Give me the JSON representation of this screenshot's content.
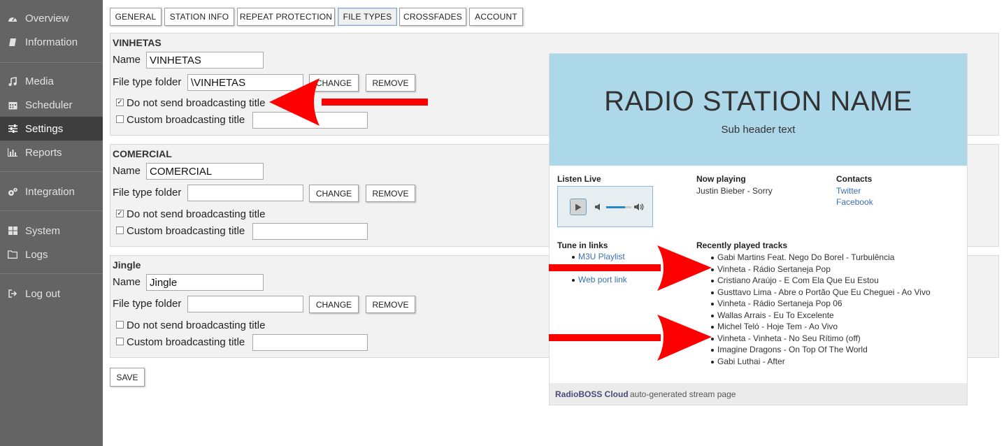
{
  "sidebar": {
    "items": [
      {
        "label": "Overview",
        "icon": "dashboard-icon"
      },
      {
        "label": "Information",
        "icon": "book-icon"
      },
      {
        "label": "Media",
        "icon": "music-icon"
      },
      {
        "label": "Scheduler",
        "icon": "calendar-icon"
      },
      {
        "label": "Settings",
        "icon": "sliders-icon",
        "active": true
      },
      {
        "label": "Reports",
        "icon": "bar-chart-icon"
      },
      {
        "label": "Integration",
        "icon": "cogs-icon"
      },
      {
        "label": "System",
        "icon": "windows-icon"
      },
      {
        "label": "Logs",
        "icon": "folder-icon"
      },
      {
        "label": "Log out",
        "icon": "sign-out-icon"
      }
    ]
  },
  "tabs": [
    "GENERAL",
    "STATION INFO",
    "REPEAT PROTECTION",
    "FILE TYPES",
    "CROSSFADES",
    "ACCOUNT"
  ],
  "active_tab": "FILE TYPES",
  "labels": {
    "name": "Name",
    "folder": "File type folder",
    "change": "CHANGE",
    "remove": "REMOVE",
    "no_title": "Do not send broadcasting title",
    "custom_title": "Custom broadcasting title"
  },
  "sections": [
    {
      "title": "VINHETAS",
      "name": "VINHETAS",
      "folder": "\\VINHETAS",
      "no_title_checked": true,
      "custom_checked": false,
      "custom_value": ""
    },
    {
      "title": "COMERCIAL",
      "name": "COMERCIAL",
      "folder": "",
      "no_title_checked": true,
      "custom_checked": false,
      "custom_value": ""
    },
    {
      "title": "Jingle",
      "name": "Jingle",
      "folder": "",
      "no_title_checked": false,
      "custom_checked": false,
      "custom_value": ""
    }
  ],
  "save_label": "SAVE",
  "stream_page": {
    "title": "RADIO STATION NAME",
    "subtitle": "Sub header text",
    "listen_live": "Listen Live",
    "now_playing_label": "Now playing",
    "now_playing": "Justin Bieber - Sorry",
    "contacts_label": "Contacts",
    "contacts": [
      "Twitter",
      "Facebook"
    ],
    "tune_in_label": "Tune in links",
    "tune_in": [
      "M3U Playlist",
      "Web port link"
    ],
    "recent_label": "Recently played tracks",
    "recent": [
      "Gabi Martins Feat. Nego Do Borel - Turbulência",
      "Vinheta - Rádio Sertaneja Pop",
      "Cristiano Araújo - E Com Ela Que Eu Estou",
      "Gusttavo Lima - Abre o Portão Que Eu Cheguei - Ao Vivo",
      "Vinheta - Rádio Sertaneja Pop 06",
      "Wallas Arrais - Eu To Excelente",
      "Michel Teló - Hoje Tem - Ao Vivo",
      "Vinheta - Vinheta - No Seu Rítimo (off)",
      "Imagine Dragons - On Top Of The World",
      "Gabi Luthai - After"
    ],
    "footer_brand": "RadioBOSS Cloud",
    "footer_text": "auto-generated stream page",
    "volume_level": 0.75
  },
  "colors": {
    "sidebar_bg": "#646464",
    "sidebar_active": "#3e3e3e",
    "hero_bg": "#add8ea",
    "arrow": "#ff0000",
    "link": "#3a6fb4"
  }
}
